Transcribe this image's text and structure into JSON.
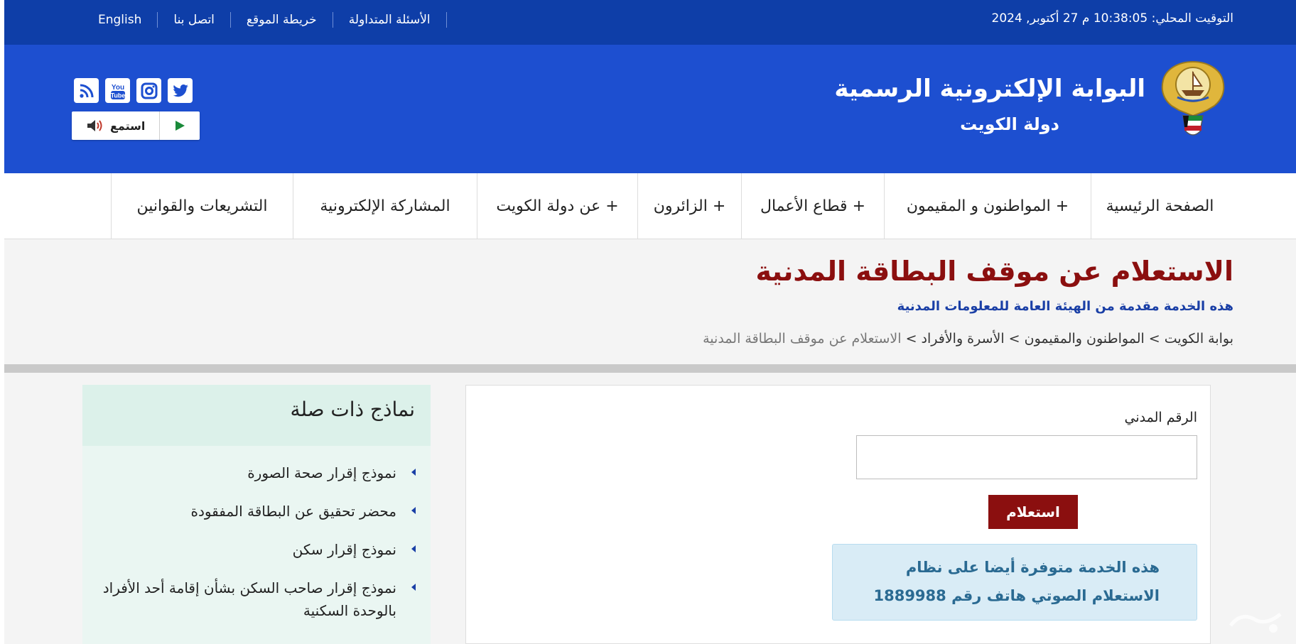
{
  "topbar": {
    "clock": "التوقيت المحلي: 10:38:05 م 27 أكتوبر, 2024",
    "links": [
      {
        "label": "الأسئلة المتداولة"
      },
      {
        "label": "خريطة الموقع"
      },
      {
        "label": "اتصل بنا"
      },
      {
        "label": "English"
      }
    ]
  },
  "header": {
    "title_main": "البوابة الإلكترونية الرسمية",
    "title_sub": "دولة الكويت",
    "social_icons": [
      "twitter-icon",
      "instagram-icon",
      "youtube-icon",
      "rss-icon"
    ],
    "youtube_text": "You Tube",
    "listen_label": "استمع"
  },
  "nav": {
    "items": [
      {
        "label": "الصفحة الرئيسية"
      },
      {
        "label": "المواطنون و المقيمون +"
      },
      {
        "label": "قطاع الأعمال +"
      },
      {
        "label": "الزائرون +"
      },
      {
        "label": "عن دولة الكويت +"
      },
      {
        "label": "المشاركة الإلكترونية"
      },
      {
        "label": "التشريعات والقوانين"
      }
    ]
  },
  "page": {
    "title": "الاستعلام عن موقف البطاقة المدنية",
    "subtitle": "هذه الخدمة مقدمة من الهيئة العامة للمعلومات المدنية",
    "breadcrumb": {
      "path": "بوابة الكويت > المواطنون والمقيمون > الأسرة والأفراد > ",
      "current": "الاستعلام عن موقف البطاقة المدنية"
    }
  },
  "form": {
    "label": "الرقم المدني",
    "input_value": "",
    "button": "استعلام",
    "info_text": "هذه الخدمة متوفرة أيضا على نظام الاستعلام الصوتي هاتف رقم",
    "info_number": "1889988"
  },
  "sidebar": {
    "title": "نماذج ذات صلة",
    "items": [
      {
        "label": "نموذج إقرار صحة الصورة"
      },
      {
        "label": "محضر تحقيق عن البطاقة المفقودة"
      },
      {
        "label": "نموذج إقرار سكن"
      },
      {
        "label": "نموذج إقرار صاحب السكن بشأن إقامة أحد الأفراد بالوحدة السكنية"
      }
    ]
  },
  "colors": {
    "topbar": "#0e3ea8",
    "header": "#1d4fd0",
    "title_red": "#8b0f0f",
    "subtitle_blue": "#1a3fa6",
    "info_bg": "#d9ecf6",
    "sidebar_bg": "#eaf6f2"
  }
}
